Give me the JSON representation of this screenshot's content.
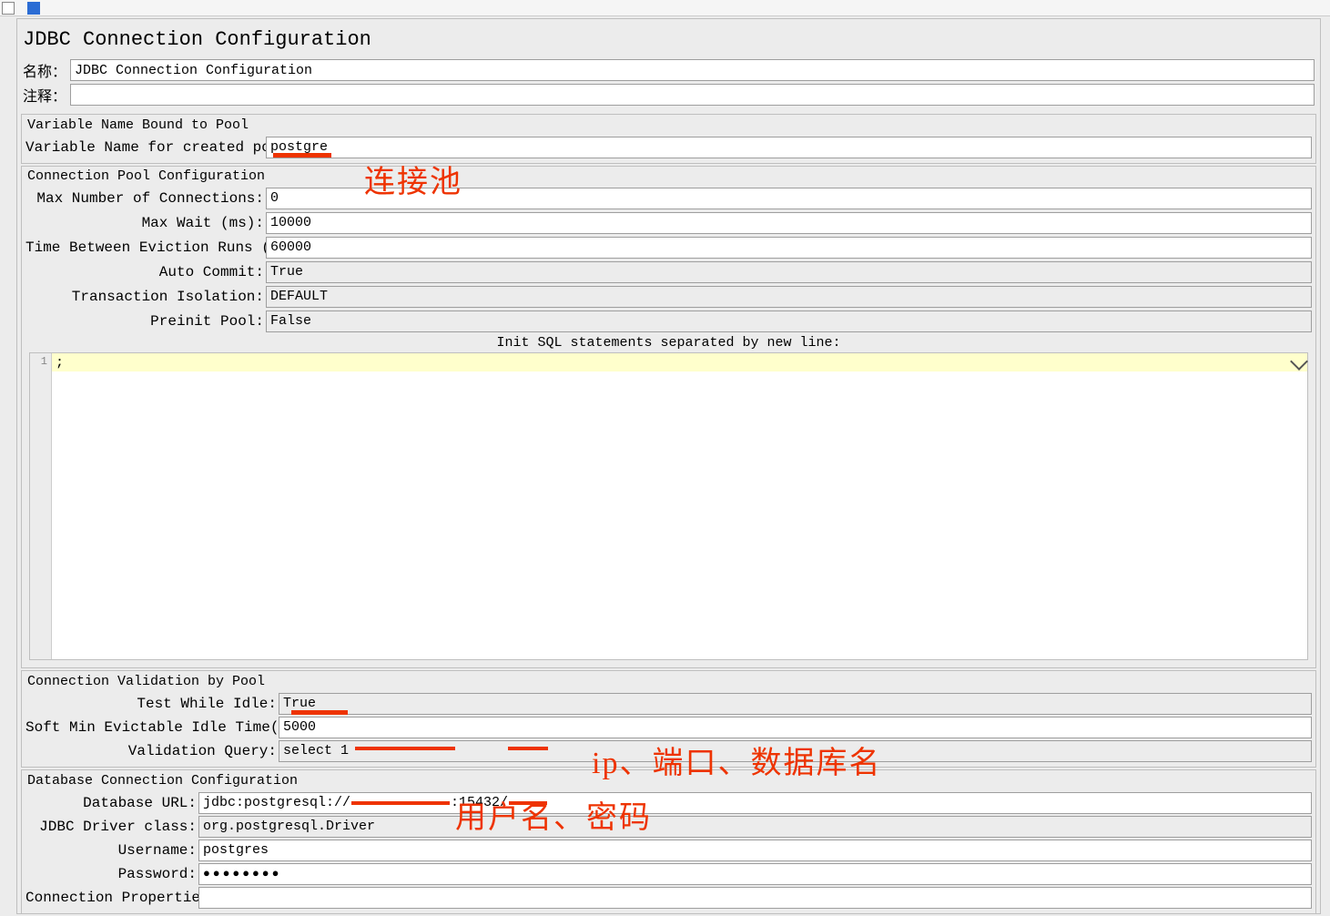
{
  "title": "JDBC Connection Configuration",
  "labels": {
    "name": "名称：",
    "comment": "注释："
  },
  "name_value": "JDBC Connection Configuration",
  "comment_value": "",
  "var_pool": {
    "group_title": "Variable Name Bound to Pool",
    "label": "Variable Name for created pool:",
    "value": "postgre"
  },
  "conn_pool": {
    "group_title": "Connection Pool Configuration",
    "max_conn_label": "Max Number of Connections:",
    "max_conn_value": "0",
    "max_wait_label": "Max Wait (ms):",
    "max_wait_value": "10000",
    "time_between_label": "Time Between Eviction Runs (ms):",
    "time_between_value": "60000",
    "auto_commit_label": "Auto Commit:",
    "auto_commit_value": "True",
    "tx_iso_label": "Transaction Isolation:",
    "tx_iso_value": "DEFAULT",
    "preinit_label": "Preinit Pool:",
    "preinit_value": "False",
    "init_sql_label": "Init SQL statements separated by new line:",
    "sql_line_no": "1",
    "sql_text": ";"
  },
  "validation": {
    "group_title": "Connection Validation by Pool",
    "test_idle_label": "Test While Idle:",
    "test_idle_value": "True",
    "soft_min_label": "Soft Min Evictable Idle Time(ms):",
    "soft_min_value": "5000",
    "val_query_label": "Validation Query:",
    "val_query_value": "select 1"
  },
  "db": {
    "group_title": "Database Connection Configuration",
    "url_label": "Database URL:",
    "url_prefix": "jdbc:postgresql://",
    "url_port": ":15432/",
    "driver_label": "JDBC Driver class:",
    "driver_value": "org.postgresql.Driver",
    "user_label": "Username:",
    "user_value": "postgres",
    "pwd_label": "Password:",
    "pwd_value": "●●●●●●●●",
    "props_label": "Connection Properties:"
  },
  "annotations": {
    "pool": "连接池",
    "url": "ip、端口、数据库名",
    "cred": "用户名、密码"
  }
}
